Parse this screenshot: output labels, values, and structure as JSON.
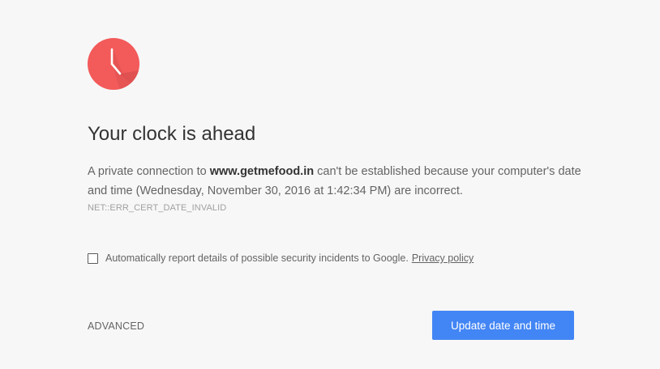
{
  "colors": {
    "background": "#f7f7f7",
    "clock_face": "#f35a5a",
    "clock_shadow": "#cf4a4a",
    "primary_button": "#4285f4"
  },
  "icon": {
    "name": "clock-icon"
  },
  "title": "Your clock is ahead",
  "message": {
    "prefix": "A private connection to ",
    "domain": "www.getmefood.in",
    "suffix": " can't be established because your computer's date and time (Wednesday, November 30, 2016 at 1:42:34 PM) are incorrect."
  },
  "error_code": "NET::ERR_CERT_DATE_INVALID",
  "report": {
    "checked": false,
    "label": "Automatically report details of possible security incidents to Google.",
    "privacy_link": "Privacy policy"
  },
  "advanced_label": "ADVANCED",
  "primary_button_label": "Update date and time"
}
